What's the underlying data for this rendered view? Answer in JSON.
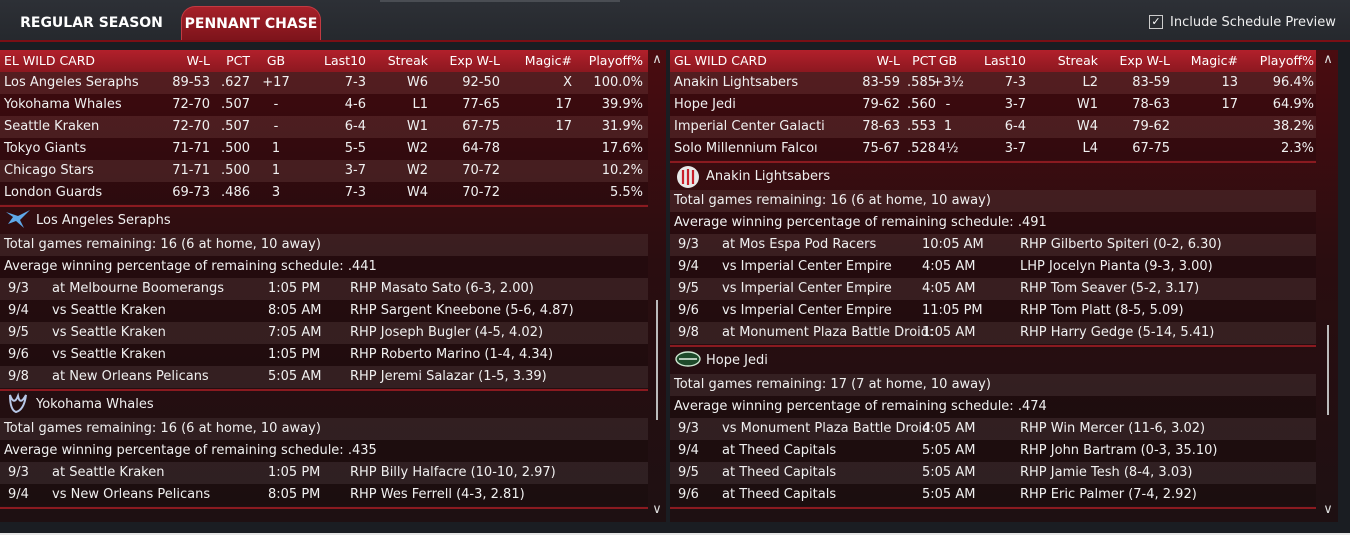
{
  "tabs": [
    {
      "label": "REGULAR SEASON"
    },
    {
      "label": "PENNANT CHASE"
    }
  ],
  "include_preview": {
    "label": "Include Schedule Preview",
    "checked": true,
    "check_glyph": "✓"
  },
  "headers": {
    "left": [
      "EL  WILD CARD",
      "W-L",
      "PCT",
      "GB",
      "Last10",
      "Streak",
      "Exp W-L",
      "Magic#",
      "Playoff%"
    ],
    "right": [
      "GL  WILD CARD",
      "W-L",
      "PCT",
      "GB",
      "Last10",
      "Streak",
      "Exp W-L",
      "Magic#",
      "Playoff%"
    ]
  },
  "standings_left": [
    [
      "Los Angeles Seraphs",
      "89-53",
      ".627",
      "+17",
      "7-3",
      "W6",
      "92-50",
      "X",
      "100.0%"
    ],
    [
      "Yokohama Whales",
      "72-70",
      ".507",
      "-",
      "4-6",
      "L1",
      "77-65",
      "17",
      "39.9%"
    ],
    [
      "Seattle Kraken",
      "72-70",
      ".507",
      "-",
      "6-4",
      "W1",
      "67-75",
      "17",
      "31.9%"
    ],
    [
      "Tokyo Giants",
      "71-71",
      ".500",
      "1",
      "5-5",
      "W2",
      "64-78",
      "",
      "17.6%"
    ],
    [
      "Chicago Stars",
      "71-71",
      ".500",
      "1",
      "3-7",
      "W2",
      "70-72",
      "",
      "10.2%"
    ],
    [
      "London Guards",
      "69-73",
      ".486",
      "3",
      "7-3",
      "W4",
      "70-72",
      "",
      "5.5%"
    ]
  ],
  "standings_right": [
    [
      "Anakin Lightsabers",
      "83-59",
      ".585",
      "+3½",
      "7-3",
      "L2",
      "83-59",
      "13",
      "96.4%"
    ],
    [
      "Hope Jedi",
      "79-62",
      ".560",
      "-",
      "3-7",
      "W1",
      "78-63",
      "17",
      "64.9%"
    ],
    [
      "Imperial Center Galacti",
      "78-63",
      ".553",
      "1",
      "6-4",
      "W4",
      "79-62",
      "",
      "38.2%"
    ],
    [
      "Solo Millennium Falcoı",
      "75-67",
      ".528",
      "4½",
      "3-7",
      "L4",
      "67-75",
      "",
      "2.3%"
    ]
  ],
  "schedules_left": [
    {
      "team": "Los Angeles Seraphs",
      "total": "Total games remaining: 16 (6 at home, 10 away)",
      "avg": "Average winning percentage of remaining schedule: .441",
      "games": [
        [
          "9/3",
          "at Melbourne Boomerangs",
          "1:05 PM",
          "RHP Masato Sato (6-3, 2.00)"
        ],
        [
          "9/4",
          "vs Seattle Kraken",
          "8:05 AM",
          "RHP Sargent Kneebone (5-6, 4.87)"
        ],
        [
          "9/5",
          "vs Seattle Kraken",
          "7:05 AM",
          "RHP Joseph Bugler (4-5, 4.02)"
        ],
        [
          "9/6",
          "vs Seattle Kraken",
          "1:05 PM",
          "RHP Roberto Marino (1-4, 4.34)"
        ],
        [
          "9/8",
          "at New Orleans Pelicans",
          "5:05 AM",
          "RHP Jeremi Salazar (1-5, 3.39)"
        ]
      ]
    },
    {
      "team": "Yokohama Whales",
      "total": "Total games remaining: 16 (6 at home, 10 away)",
      "avg": "Average winning percentage of remaining schedule: .435",
      "games": [
        [
          "9/3",
          "at Seattle Kraken",
          "1:05 PM",
          "RHP Billy Halfacre (10-10, 2.97)"
        ],
        [
          "9/4",
          "vs New Orleans Pelicans",
          "8:05 PM",
          "RHP Wes Ferrell (4-3, 2.81)"
        ]
      ]
    }
  ],
  "schedules_right": [
    {
      "team": "Anakin Lightsabers",
      "total": "Total games remaining: 16 (6 at home, 10 away)",
      "avg": "Average winning percentage of remaining schedule: .491",
      "games": [
        [
          "9/3",
          "at Mos Espa Pod Racers",
          "10:05 AM",
          "RHP Gilberto Spiteri (0-2, 6.30)"
        ],
        [
          "9/4",
          "vs Imperial Center Empire",
          "4:05 AM",
          "LHP Jocelyn Pianta (9-3, 3.00)"
        ],
        [
          "9/5",
          "vs Imperial Center Empire",
          "4:05 AM",
          "RHP Tom Seaver (5-2, 3.17)"
        ],
        [
          "9/6",
          "vs Imperial Center Empire",
          "11:05 PM",
          "RHP Tom Platt (8-5, 5.09)"
        ],
        [
          "9/8",
          "at Monument Plaza Battle Droid:",
          "1:05 AM",
          "RHP Harry Gedge (5-14, 5.41)"
        ]
      ]
    },
    {
      "team": "Hope Jedi",
      "total": "Total games remaining: 17 (7 at home, 10 away)",
      "avg": "Average winning percentage of remaining schedule: .474",
      "games": [
        [
          "9/3",
          "vs Monument Plaza Battle Droid",
          "4:05 AM",
          "RHP Win Mercer (11-6, 3.02)"
        ],
        [
          "9/4",
          "at Theed Capitals",
          "5:05 AM",
          "RHP John Bartram (0-3, 35.10)"
        ],
        [
          "9/5",
          "at Theed Capitals",
          "5:05 AM",
          "RHP Jamie Tesh (8-4, 3.03)"
        ],
        [
          "9/6",
          "at Theed Capitals",
          "5:05 AM",
          "RHP Eric Palmer (7-4, 2.92)"
        ]
      ]
    }
  ],
  "scroll": {
    "up": "∧",
    "down": "∨"
  },
  "colors": {
    "accent": "#a62029",
    "header": "#b2202b",
    "background": "#1a1d22"
  }
}
